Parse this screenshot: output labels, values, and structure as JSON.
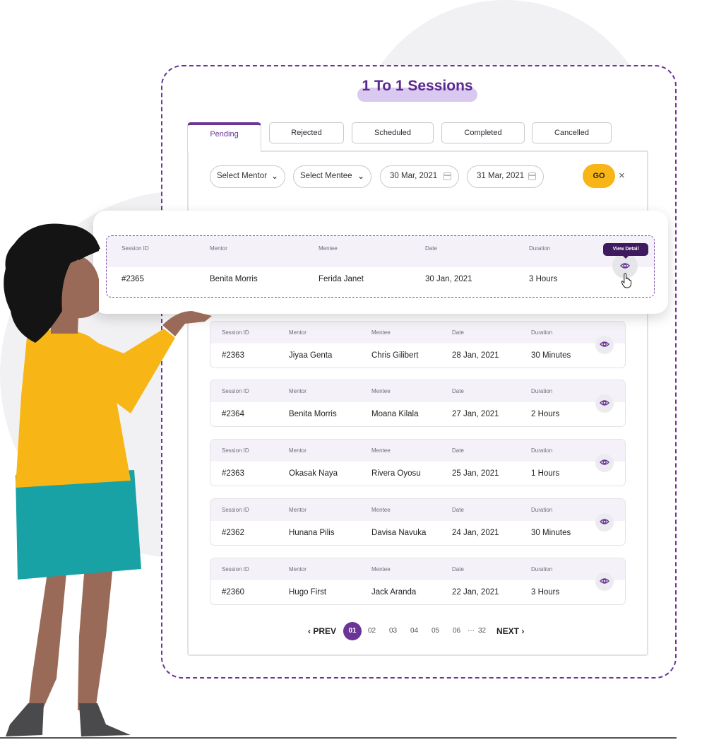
{
  "page_title": "1 To 1 Sessions",
  "tabs": [
    {
      "label": "Pending",
      "active": true
    },
    {
      "label": "Rejected",
      "active": false
    },
    {
      "label": "Scheduled",
      "active": false
    },
    {
      "label": "Completed",
      "active": false
    },
    {
      "label": "Cancelled",
      "active": false
    }
  ],
  "filters": {
    "mentor_select": "Select Mentor",
    "mentee_select": "Select Mentee",
    "start_date": "30 Mar, 2021",
    "end_date": "31 Mar, 2021",
    "go_label": "GO",
    "clear_label": "×"
  },
  "columns": {
    "session_id": "Session ID",
    "mentor": "Mentor",
    "mentee": "Mentee",
    "date": "Date",
    "duration": "Duration"
  },
  "highlighted_session": {
    "id": "#2365",
    "mentor": "Benita Morris",
    "mentee": "Ferida Janet",
    "date": "30 Jan, 2021",
    "duration": "3 Hours",
    "tooltip": "View Detail"
  },
  "sessions": [
    {
      "id": "#2363",
      "mentor": "Jiyaa Genta",
      "mentee": "Chris Gilibert",
      "date": "28 Jan, 2021",
      "duration": "30 Minutes"
    },
    {
      "id": "#2364",
      "mentor": "Benita Morris",
      "mentee": "Moana Kilala",
      "date": "27 Jan, 2021",
      "duration": "2 Hours"
    },
    {
      "id": "#2363",
      "mentor": "Okasak Naya",
      "mentee": "Rivera Oyosu",
      "date": "25 Jan, 2021",
      "duration": "1 Hours"
    },
    {
      "id": "#2362",
      "mentor": "Hunana Pilis",
      "mentee": "Davisa Navuka",
      "date": "24 Jan, 2021",
      "duration": "30 Minutes"
    },
    {
      "id": "#2360",
      "mentor": "Hugo First",
      "mentee": "Jack Aranda",
      "date": "22 Jan, 2021",
      "duration": "3 Hours"
    }
  ],
  "pagination": {
    "prev": "‹ PREV",
    "pages": [
      "01",
      "02",
      "03",
      "04",
      "05",
      "06"
    ],
    "ellipsis": "···",
    "last": "32",
    "next": "NEXT ›",
    "current": "01"
  },
  "colors": {
    "accent": "#6a3596",
    "go_button": "#f8b516",
    "tooltip": "#3e1a5e"
  }
}
